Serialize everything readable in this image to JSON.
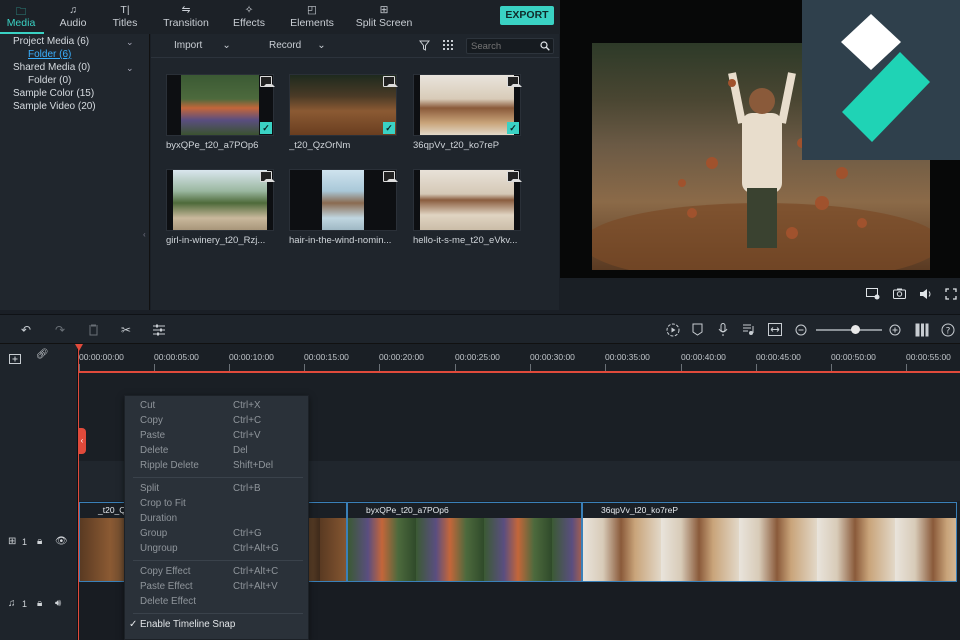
{
  "tabs": [
    {
      "label": "Media",
      "icon": "folder-icon",
      "glyph": "🗀"
    },
    {
      "label": "Audio",
      "icon": "music-note-icon",
      "glyph": "♫"
    },
    {
      "label": "Titles",
      "icon": "titles-icon",
      "glyph": "T|"
    },
    {
      "label": "Transition",
      "icon": "transition-icon",
      "glyph": "⇋"
    },
    {
      "label": "Effects",
      "icon": "effects-icon",
      "glyph": "✧"
    },
    {
      "label": "Elements",
      "icon": "elements-icon",
      "glyph": "◰"
    },
    {
      "label": "Split Screen",
      "icon": "split-screen-icon",
      "glyph": "⊞"
    }
  ],
  "export_label": "EXPORT",
  "tree": [
    {
      "label": "Project Media (6)",
      "expandable": true
    },
    {
      "label": "Folder (6)",
      "selected": true,
      "folder": true
    },
    {
      "label": "Shared Media (0)",
      "expandable": true
    },
    {
      "label": "Folder (0)",
      "folder": true
    },
    {
      "label": "Sample Color (15)"
    },
    {
      "label": "Sample Video (20)"
    }
  ],
  "media_toolbar": {
    "import_label": "Import",
    "record_label": "Record",
    "search_placeholder": "Search"
  },
  "media_items": [
    {
      "name": "byxQPe_t20_a7POp6",
      "checked": true
    },
    {
      "name": "_t20_QzOrNm",
      "checked": true
    },
    {
      "name": "36qpVv_t20_ko7reP",
      "checked": true
    },
    {
      "name": "girl-in-winery_t20_Rzj...",
      "checked": false
    },
    {
      "name": "hair-in-the-wind-nomin...",
      "checked": false
    },
    {
      "name": "hello-it-s-me_t20_eVkv...",
      "checked": false
    }
  ],
  "ruler_ticks": [
    "00:00:00:00",
    "00:00:05:00",
    "00:00:10:00",
    "00:00:15:00",
    "00:00:20:00",
    "00:00:25:00",
    "00:00:30:00",
    "00:00:35:00",
    "00:00:40:00",
    "00:00:45:00",
    "00:00:50:00",
    "00:00:55:00"
  ],
  "zoom_level": 0.6,
  "track_labels": {
    "video": "1",
    "audio": "1"
  },
  "clips": [
    {
      "name": "_t20_Qz"
    },
    {
      "name": "byxQPe_t20_a7POp6"
    },
    {
      "name": "36qpVv_t20_ko7reP"
    }
  ],
  "context_menu": [
    {
      "label": "Cut",
      "shortcut": "Ctrl+X"
    },
    {
      "label": "Copy",
      "shortcut": "Ctrl+C"
    },
    {
      "label": "Paste",
      "shortcut": "Ctrl+V"
    },
    {
      "label": "Delete",
      "shortcut": "Del"
    },
    {
      "label": "Ripple Delete",
      "shortcut": "Shift+Del"
    },
    {
      "label": "Split",
      "shortcut": "Ctrl+B"
    },
    {
      "label": "Crop to Fit",
      "shortcut": ""
    },
    {
      "label": "Duration",
      "shortcut": ""
    },
    {
      "label": "Group",
      "shortcut": "Ctrl+G"
    },
    {
      "label": "Ungroup",
      "shortcut": "Ctrl+Alt+G"
    },
    {
      "label": "Copy Effect",
      "shortcut": "Ctrl+Alt+C"
    },
    {
      "label": "Paste Effect",
      "shortcut": "Ctrl+Alt+V"
    },
    {
      "label": "Delete Effect",
      "shortcut": ""
    },
    {
      "label": "Enable Timeline Snap",
      "shortcut": "",
      "checked": true,
      "enabled": true
    }
  ],
  "colors": {
    "accent": "#3ad2c4",
    "playhead": "#e04a3b",
    "clip_border": "#3a80b8"
  }
}
